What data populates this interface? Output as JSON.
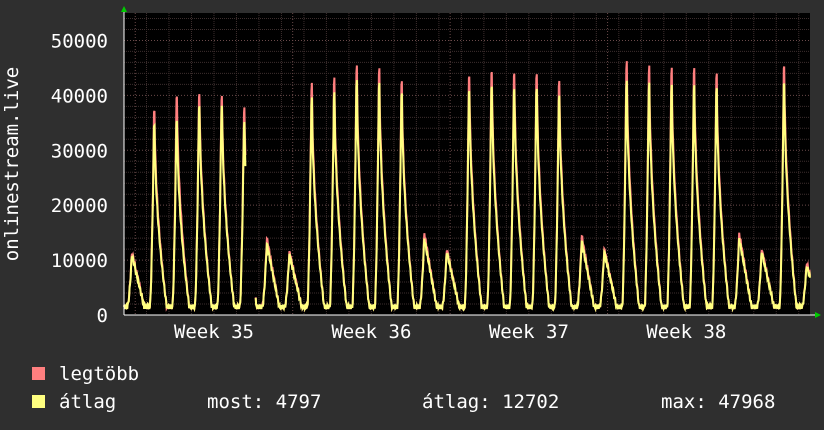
{
  "chart_data": {
    "type": "line",
    "ylabel": "onlinestream.live",
    "ylim": [
      0,
      55000
    ],
    "yticks": [
      0,
      10000,
      20000,
      30000,
      40000,
      50000
    ],
    "ytick_labels": [
      "0",
      "10000",
      "20000",
      "30000",
      "40000",
      "50000"
    ],
    "x_unit": "days",
    "xlim": [
      0,
      30.5
    ],
    "xticks": [
      {
        "label": "Week 35",
        "x": 4.0
      },
      {
        "label": "Week 36",
        "x": 11.0
      },
      {
        "label": "Week 37",
        "x": 18.0
      },
      {
        "label": "Week 38",
        "x": 25.0
      }
    ],
    "grid": true,
    "series": [
      {
        "name": "legtöbb",
        "color": "#ff7f7f",
        "role": "max"
      },
      {
        "name": "átlag",
        "color": "#ffff80",
        "role": "avg"
      }
    ],
    "daily_peaks": {
      "days": [
        0,
        1,
        2,
        3,
        4,
        5,
        6,
        7,
        8,
        9,
        10,
        11,
        12,
        13,
        14,
        15,
        16,
        17,
        18,
        19,
        20,
        21,
        22,
        23,
        24,
        25,
        26,
        27,
        28,
        29,
        30
      ],
      "legtobb": [
        11500,
        42000,
        45000,
        45500,
        45000,
        42500,
        14000,
        11500,
        47000,
        48000,
        50500,
        50000,
        47500,
        15000,
        12000,
        49000,
        50000,
        49700,
        49500,
        48000,
        14500,
        12000,
        51500,
        50500,
        50000,
        50000,
        49000,
        15000,
        12000,
        51000,
        9500
      ],
      "atlag": [
        11000,
        39000,
        40000,
        43000,
        43000,
        39500,
        13000,
        11000,
        44000,
        45000,
        47500,
        47000,
        45000,
        14000,
        11500,
        46000,
        47000,
        46500,
        46500,
        45000,
        13500,
        11500,
        47500,
        47000,
        46500,
        46500,
        46000,
        14000,
        11500,
        47500,
        9000
      ]
    },
    "gap_after_day": 5.4
  },
  "legend": [
    {
      "label": "legtöbb",
      "color": "#ff7f7f"
    },
    {
      "label": "átlag",
      "color": "#ffff80"
    }
  ],
  "stats": {
    "most": "most: 4797",
    "atlag": "átlag: 12702",
    "max": "max: 47968"
  }
}
